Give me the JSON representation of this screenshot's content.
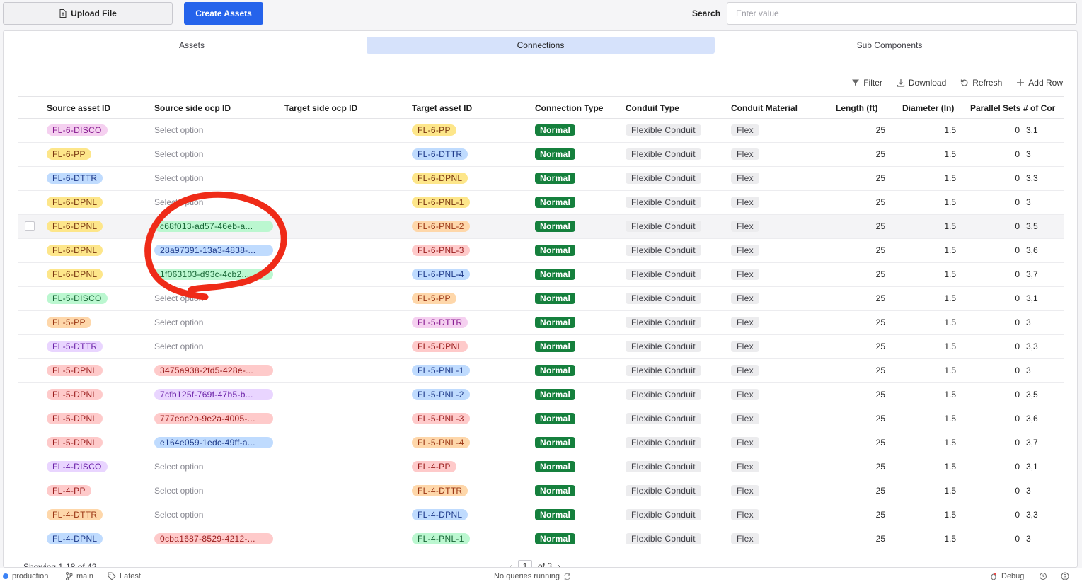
{
  "topbar": {
    "upload_label": "Upload File",
    "create_label": "Create Assets",
    "search_label": "Search",
    "search_placeholder": "Enter value"
  },
  "tabs": [
    {
      "label": "Assets",
      "active": false
    },
    {
      "label": "Connections",
      "active": true
    },
    {
      "label": "Sub Components",
      "active": false
    }
  ],
  "toolbar": {
    "filter": "Filter",
    "download": "Download",
    "refresh": "Refresh",
    "add_row": "Add Row"
  },
  "columns": [
    "Source asset ID",
    "Source side ocp ID",
    "Target side ocp ID",
    "Target asset ID",
    "Connection Type",
    "Conduit Type",
    "Conduit Material",
    "Length (ft)",
    "Diameter (In)",
    "Parallel Sets",
    "# of Cor"
  ],
  "colors": {
    "pink": [
      "#f5d0f0",
      "#86198f"
    ],
    "yellow": [
      "#fde68a",
      "#78350f"
    ],
    "blue": [
      "#bfdbfe",
      "#1e3a8a"
    ],
    "orange": [
      "#fed7aa",
      "#9a3412"
    ],
    "purple": [
      "#e9d5ff",
      "#6b21a8"
    ],
    "red": [
      "#fecaca",
      "#991b1b"
    ],
    "green": [
      "#bbf7d0",
      "#166534"
    ],
    "brand_blue": "#2563eb",
    "annotation_red": "#ef2b18"
  },
  "rows": [
    {
      "src": "FL-6-DISCO",
      "src_c": "pink",
      "ocp": "Select option",
      "ocp_c": null,
      "tgt": "FL-6-PP",
      "tgt_c": "yellow",
      "conn": "Normal",
      "ctype": "Flexible Conduit",
      "mat": "Flex",
      "len": "25",
      "dia": "1.5",
      "par": "0",
      "cor": "3,1"
    },
    {
      "src": "FL-6-PP",
      "src_c": "yellow",
      "ocp": "Select option",
      "ocp_c": null,
      "tgt": "FL-6-DTTR",
      "tgt_c": "blue",
      "conn": "Normal",
      "ctype": "Flexible Conduit",
      "mat": "Flex",
      "len": "25",
      "dia": "1.5",
      "par": "0",
      "cor": "3"
    },
    {
      "src": "FL-6-DTTR",
      "src_c": "blue",
      "ocp": "Select option",
      "ocp_c": null,
      "tgt": "FL-6-DPNL",
      "tgt_c": "yellow",
      "conn": "Normal",
      "ctype": "Flexible Conduit",
      "mat": "Flex",
      "len": "25",
      "dia": "1.5",
      "par": "0",
      "cor": "3,3"
    },
    {
      "src": "FL-6-DPNL",
      "src_c": "yellow",
      "ocp": "Select option",
      "ocp_c": null,
      "tgt": "FL-6-PNL-1",
      "tgt_c": "yellow",
      "conn": "Normal",
      "ctype": "Flexible Conduit",
      "mat": "Flex",
      "len": "25",
      "dia": "1.5",
      "par": "0",
      "cor": "3"
    },
    {
      "src": "FL-6-DPNL",
      "src_c": "yellow",
      "ocp": "c68f013-ad57-46eb-a...",
      "ocp_c": "green",
      "tgt": "FL-6-PNL-2",
      "tgt_c": "orange",
      "conn": "Normal",
      "ctype": "Flexible Conduit",
      "mat": "Flex",
      "len": "25",
      "dia": "1.5",
      "par": "0",
      "cor": "3,5",
      "hl": true
    },
    {
      "src": "FL-6-DPNL",
      "src_c": "yellow",
      "ocp": "28a97391-13a3-4838-...",
      "ocp_c": "blue",
      "tgt": "FL-6-PNL-3",
      "tgt_c": "red",
      "conn": "Normal",
      "ctype": "Flexible Conduit",
      "mat": "Flex",
      "len": "25",
      "dia": "1.5",
      "par": "0",
      "cor": "3,6"
    },
    {
      "src": "FL-6-DPNL",
      "src_c": "yellow",
      "ocp": "1f063103-d93c-4cb2...",
      "ocp_c": "green",
      "tgt": "FL-6-PNL-4",
      "tgt_c": "blue",
      "conn": "Normal",
      "ctype": "Flexible Conduit",
      "mat": "Flex",
      "len": "25",
      "dia": "1.5",
      "par": "0",
      "cor": "3,7"
    },
    {
      "src": "FL-5-DISCO",
      "src_c": "green",
      "ocp": "Select option",
      "ocp_c": null,
      "tgt": "FL-5-PP",
      "tgt_c": "orange",
      "conn": "Normal",
      "ctype": "Flexible Conduit",
      "mat": "Flex",
      "len": "25",
      "dia": "1.5",
      "par": "0",
      "cor": "3,1"
    },
    {
      "src": "FL-5-PP",
      "src_c": "orange",
      "ocp": "Select option",
      "ocp_c": null,
      "tgt": "FL-5-DTTR",
      "tgt_c": "pink",
      "conn": "Normal",
      "ctype": "Flexible Conduit",
      "mat": "Flex",
      "len": "25",
      "dia": "1.5",
      "par": "0",
      "cor": "3"
    },
    {
      "src": "FL-5-DTTR",
      "src_c": "purple",
      "ocp": "Select option",
      "ocp_c": null,
      "tgt": "FL-5-DPNL",
      "tgt_c": "red",
      "conn": "Normal",
      "ctype": "Flexible Conduit",
      "mat": "Flex",
      "len": "25",
      "dia": "1.5",
      "par": "0",
      "cor": "3,3"
    },
    {
      "src": "FL-5-DPNL",
      "src_c": "red",
      "ocp": "3475a938-2fd5-428e-...",
      "ocp_c": "red",
      "tgt": "FL-5-PNL-1",
      "tgt_c": "blue",
      "conn": "Normal",
      "ctype": "Flexible Conduit",
      "mat": "Flex",
      "len": "25",
      "dia": "1.5",
      "par": "0",
      "cor": "3"
    },
    {
      "src": "FL-5-DPNL",
      "src_c": "red",
      "ocp": "7cfb125f-769f-47b5-b...",
      "ocp_c": "purple",
      "tgt": "FL-5-PNL-2",
      "tgt_c": "blue",
      "conn": "Normal",
      "ctype": "Flexible Conduit",
      "mat": "Flex",
      "len": "25",
      "dia": "1.5",
      "par": "0",
      "cor": "3,5"
    },
    {
      "src": "FL-5-DPNL",
      "src_c": "red",
      "ocp": "777eac2b-9e2a-4005-...",
      "ocp_c": "red",
      "tgt": "FL-5-PNL-3",
      "tgt_c": "red",
      "conn": "Normal",
      "ctype": "Flexible Conduit",
      "mat": "Flex",
      "len": "25",
      "dia": "1.5",
      "par": "0",
      "cor": "3,6"
    },
    {
      "src": "FL-5-DPNL",
      "src_c": "red",
      "ocp": "e164e059-1edc-49ff-a...",
      "ocp_c": "blue",
      "tgt": "FL-5-PNL-4",
      "tgt_c": "orange",
      "conn": "Normal",
      "ctype": "Flexible Conduit",
      "mat": "Flex",
      "len": "25",
      "dia": "1.5",
      "par": "0",
      "cor": "3,7"
    },
    {
      "src": "FL-4-DISCO",
      "src_c": "purple",
      "ocp": "Select option",
      "ocp_c": null,
      "tgt": "FL-4-PP",
      "tgt_c": "red",
      "conn": "Normal",
      "ctype": "Flexible Conduit",
      "mat": "Flex",
      "len": "25",
      "dia": "1.5",
      "par": "0",
      "cor": "3,1"
    },
    {
      "src": "FL-4-PP",
      "src_c": "red",
      "ocp": "Select option",
      "ocp_c": null,
      "tgt": "FL-4-DTTR",
      "tgt_c": "orange",
      "conn": "Normal",
      "ctype": "Flexible Conduit",
      "mat": "Flex",
      "len": "25",
      "dia": "1.5",
      "par": "0",
      "cor": "3"
    },
    {
      "src": "FL-4-DTTR",
      "src_c": "orange",
      "ocp": "Select option",
      "ocp_c": null,
      "tgt": "FL-4-DPNL",
      "tgt_c": "blue",
      "conn": "Normal",
      "ctype": "Flexible Conduit",
      "mat": "Flex",
      "len": "25",
      "dia": "1.5",
      "par": "0",
      "cor": "3,3"
    },
    {
      "src": "FL-4-DPNL",
      "src_c": "blue",
      "ocp": "0cba1687-8529-4212-...",
      "ocp_c": "red",
      "tgt": "FL-4-PNL-1",
      "tgt_c": "green",
      "conn": "Normal",
      "ctype": "Flexible Conduit",
      "mat": "Flex",
      "len": "25",
      "dia": "1.5",
      "par": "0",
      "cor": "3"
    }
  ],
  "footer": {
    "showing": "Showing 1-18 of 42",
    "page": "1",
    "of_pages": "of 3"
  },
  "statusbar": {
    "env": "production",
    "branch": "main",
    "version": "Latest",
    "queries": "No queries running",
    "debug": "Debug"
  }
}
